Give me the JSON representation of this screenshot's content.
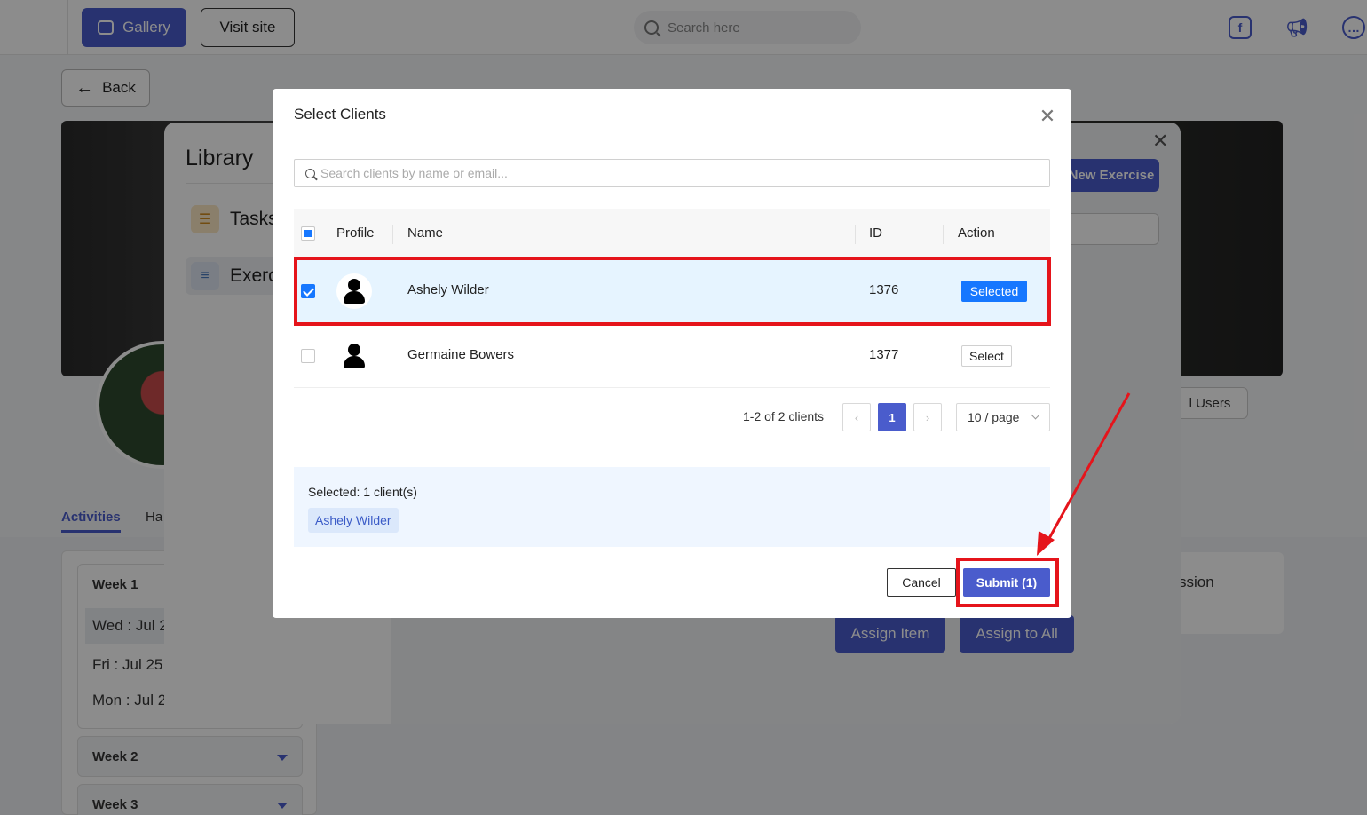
{
  "app": {
    "gallery_label": "Gallery",
    "visit_site_label": "Visit site",
    "search_placeholder": "Search here",
    "back_label": "Back",
    "users_chip": "l Users",
    "tabs": {
      "activities": "Activities",
      "habits": "Ha"
    },
    "weeks": {
      "week1": "Week 1",
      "week2": "Week 2",
      "week3": "Week 3"
    },
    "days": [
      "Wed : Jul 2",
      "Fri : Jul 25",
      "Mon : Jul 2"
    ],
    "right_card_text": "ssion",
    "assign_item_label": "Assign Item",
    "assign_all_label": "Assign to All"
  },
  "library": {
    "title": "Library",
    "items": [
      {
        "label": "Tasks",
        "icon": "tasks-icon"
      },
      {
        "label": "Exerc",
        "icon": "dumbbell-icon"
      }
    ],
    "new_exercise_label": "New Exercise"
  },
  "modal": {
    "title": "Select Clients",
    "search_placeholder": "Search clients by name or email...",
    "columns": {
      "profile": "Profile",
      "name": "Name",
      "id": "ID",
      "action": "Action"
    },
    "rows": [
      {
        "name": "Ashely Wilder",
        "id": "1376",
        "action": "Selected",
        "selected": true
      },
      {
        "name": "Germaine Bowers",
        "id": "1377",
        "action": "Select",
        "selected": false
      }
    ],
    "pagination": {
      "total_text": "1-2 of 2 clients",
      "current_page": "1",
      "page_size": "10 / page"
    },
    "selected_summary": "Selected: 1 client(s)",
    "selected_chip": "Ashely Wilder",
    "cancel_label": "Cancel",
    "submit_label": "Submit (1)"
  },
  "annotation_colors": {
    "highlight": "#e5141b",
    "accent": "#4a5ccc",
    "selected_blue": "#1677ff"
  }
}
